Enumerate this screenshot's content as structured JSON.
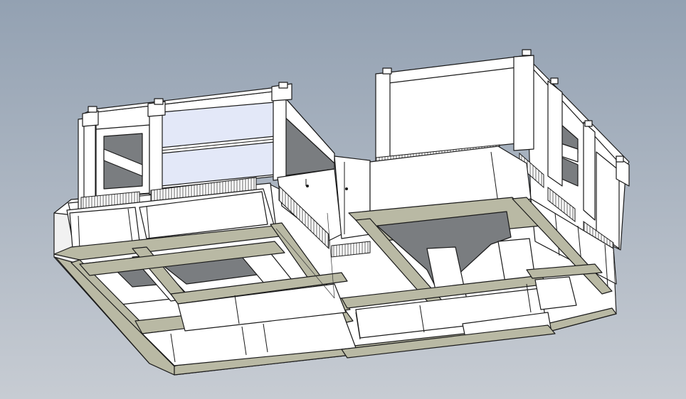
{
  "viewport": {
    "background_top": "#93a1b2",
    "background_bottom": "#c7ccd3",
    "face_color": "#ffffff",
    "section_color": "#b9b9a4",
    "interior_shadow": "#7a7d80",
    "glass_color": "#e3e8f8",
    "edge_color": "#1a1a1a"
  }
}
